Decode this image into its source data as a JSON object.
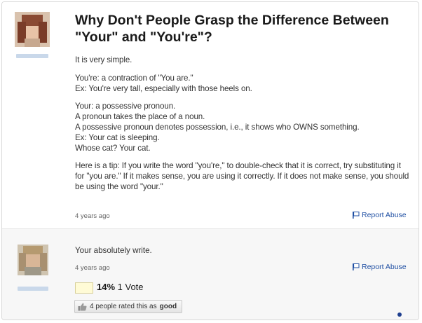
{
  "question": {
    "title": "Why Don't People Grasp the Difference Between \"Your\" and \"You're\"?",
    "paragraphs": [
      [
        "It is very simple."
      ],
      [
        "You're: a contraction of \"You are.\"",
        "Ex: You're very tall, especially with those heels on."
      ],
      [
        "Your: a possessive pronoun.",
        "A pronoun takes the place of a noun.",
        "A possessive pronoun denotes possession, i.e., it shows who OWNS something.",
        "Ex: Your cat is sleeping.",
        "Whose cat? Your cat."
      ],
      [
        "Here is a tip: If you write the word \"you're,\" to double-check that it is correct, try substituting it for \"you are.\" If it makes sense, you are using it correctly. If it does not make sense, you should be using the word \"your.\""
      ]
    ],
    "timestamp": "4 years ago",
    "report_label": "Report Abuse"
  },
  "answer": {
    "text": "Your absolutely write.",
    "timestamp": "4 years ago",
    "report_label": "Report Abuse",
    "vote_percent": "14%",
    "vote_count": "1 Vote",
    "rated_prefix": "4 people rated this as",
    "rated_word": "good"
  },
  "icons": {
    "report": "flag-icon",
    "rated": "thumbs-up-icon"
  },
  "colors": {
    "link": "#1f4fa3",
    "vote_box": "#fffbd6"
  }
}
